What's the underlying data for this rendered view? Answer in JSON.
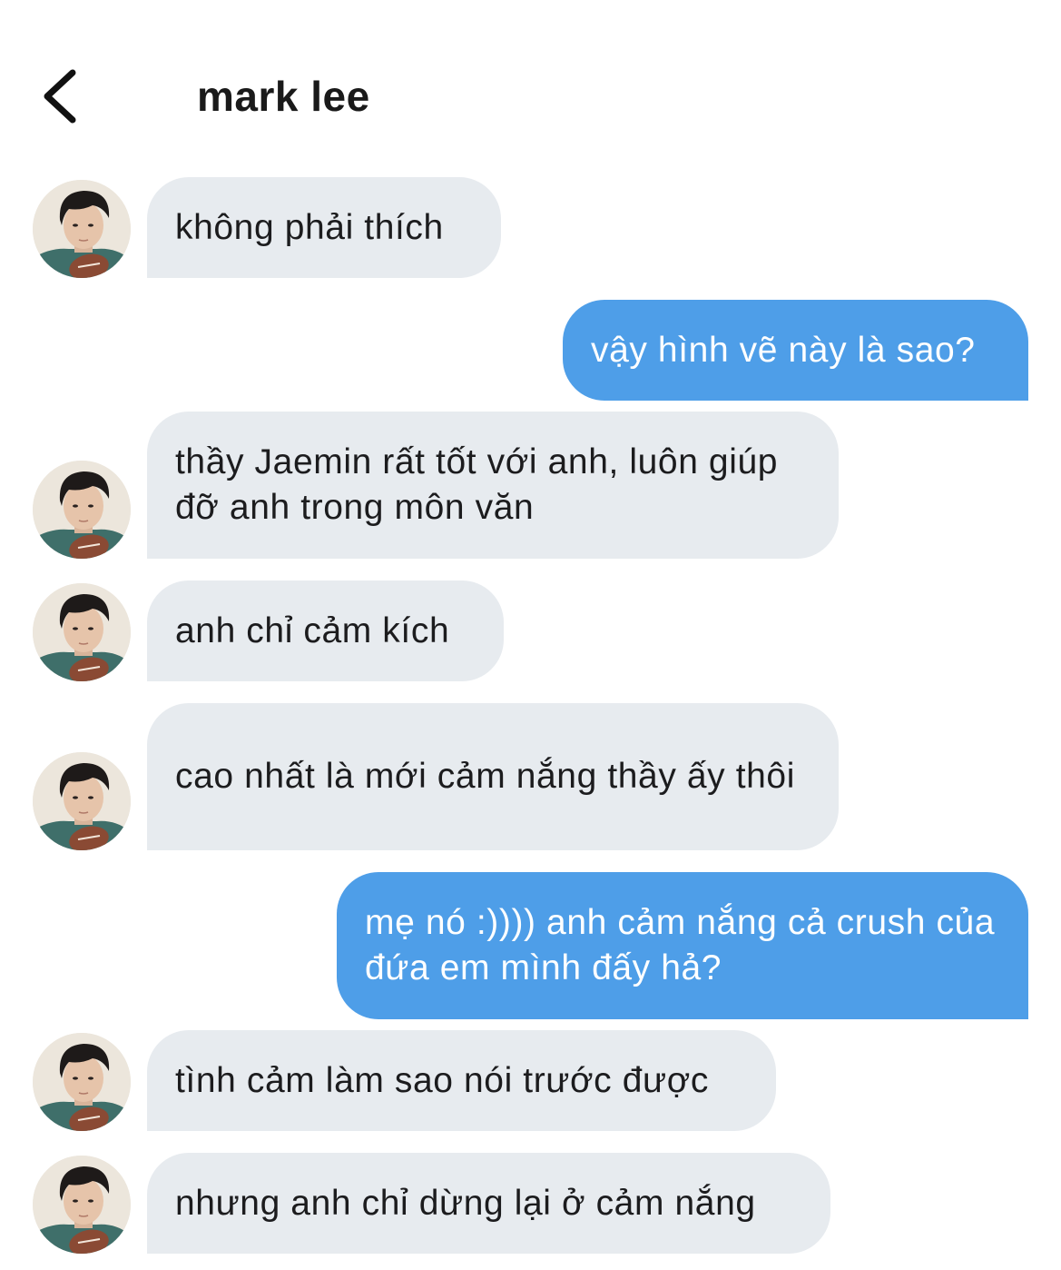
{
  "header": {
    "title": "mark lee",
    "back_icon": "chevron-left-icon"
  },
  "colors": {
    "incoming_bubble": "#e7ebef",
    "outgoing_bubble": "#4e9ee8",
    "incoming_text": "#1c1c1e",
    "outgoing_text": "#ffffff"
  },
  "messages": [
    {
      "from": "them",
      "text": "không phải thích"
    },
    {
      "from": "me",
      "text": "vậy hình vẽ này là sao?"
    },
    {
      "from": "them",
      "text": "thầy Jaemin rất tốt với anh, luôn giúp đỡ anh trong môn văn"
    },
    {
      "from": "them",
      "text": "anh chỉ cảm kích"
    },
    {
      "from": "them",
      "text": "cao nhất là mới cảm nắng thầy ấy thôi"
    },
    {
      "from": "me",
      "text": "mẹ nó :)))) anh cảm nắng cả crush của đứa em mình đấy hả?"
    },
    {
      "from": "them",
      "text": "tình cảm làm sao nói trước được"
    },
    {
      "from": "them",
      "text": "nhưng anh chỉ dừng lại ở cảm nắng"
    }
  ]
}
